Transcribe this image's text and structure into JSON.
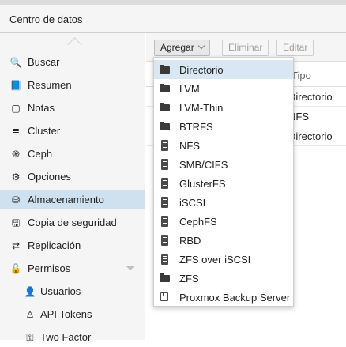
{
  "header": {
    "title": "Centro de datos"
  },
  "sidebar": {
    "items": [
      {
        "label": "Buscar",
        "icon": "search-icon",
        "glyph": "🔍",
        "active": false,
        "sub": false
      },
      {
        "label": "Resumen",
        "icon": "book-icon",
        "glyph": "📘",
        "active": false,
        "sub": false
      },
      {
        "label": "Notas",
        "icon": "sticky-note-icon",
        "glyph": "▢",
        "active": false,
        "sub": false
      },
      {
        "label": "Cluster",
        "icon": "server-stack-icon",
        "glyph": "≣",
        "active": false,
        "sub": false
      },
      {
        "label": "Ceph",
        "icon": "ceph-icon",
        "glyph": "֍",
        "active": false,
        "sub": false
      },
      {
        "label": "Opciones",
        "icon": "gear-icon",
        "glyph": "⚙",
        "active": false,
        "sub": false
      },
      {
        "label": "Almacenamiento",
        "icon": "database-icon",
        "glyph": "⛁",
        "active": true,
        "sub": false
      },
      {
        "label": "Copia de seguridad",
        "icon": "floppy-icon",
        "glyph": "🖫",
        "active": false,
        "sub": false
      },
      {
        "label": "Replicación",
        "icon": "retweet-icon",
        "glyph": "⇄",
        "active": false,
        "sub": false
      },
      {
        "label": "Permisos",
        "icon": "unlock-icon",
        "glyph": "🔓",
        "active": false,
        "sub": false,
        "expander": true
      },
      {
        "label": "Usuarios",
        "icon": "user-icon",
        "glyph": "👤",
        "active": false,
        "sub": true
      },
      {
        "label": "API Tokens",
        "icon": "user-outline-icon",
        "glyph": "♙",
        "active": false,
        "sub": true
      },
      {
        "label": "Two Factor",
        "icon": "key-icon",
        "glyph": "⚿",
        "active": false,
        "sub": true
      }
    ]
  },
  "toolbar": {
    "add_label": "Agregar",
    "remove_label": "Eliminar",
    "edit_label": "Editar"
  },
  "grid": {
    "type_header": "Tipo",
    "rows": [
      "Directorio",
      "NFS",
      "Directorio"
    ]
  },
  "add_menu": {
    "items": [
      {
        "label": "Directorio",
        "icon": "folder"
      },
      {
        "label": "LVM",
        "icon": "folder"
      },
      {
        "label": "LVM-Thin",
        "icon": "folder"
      },
      {
        "label": "BTRFS",
        "icon": "folder"
      },
      {
        "label": "NFS",
        "icon": "server"
      },
      {
        "label": "SMB/CIFS",
        "icon": "server"
      },
      {
        "label": "GlusterFS",
        "icon": "server"
      },
      {
        "label": "iSCSI",
        "icon": "server"
      },
      {
        "label": "CephFS",
        "icon": "server"
      },
      {
        "label": "RBD",
        "icon": "server"
      },
      {
        "label": "ZFS over iSCSI",
        "icon": "server"
      },
      {
        "label": "ZFS",
        "icon": "folder"
      },
      {
        "label": "Proxmox Backup Server",
        "icon": "floppy"
      }
    ],
    "hovered_index": 0
  }
}
